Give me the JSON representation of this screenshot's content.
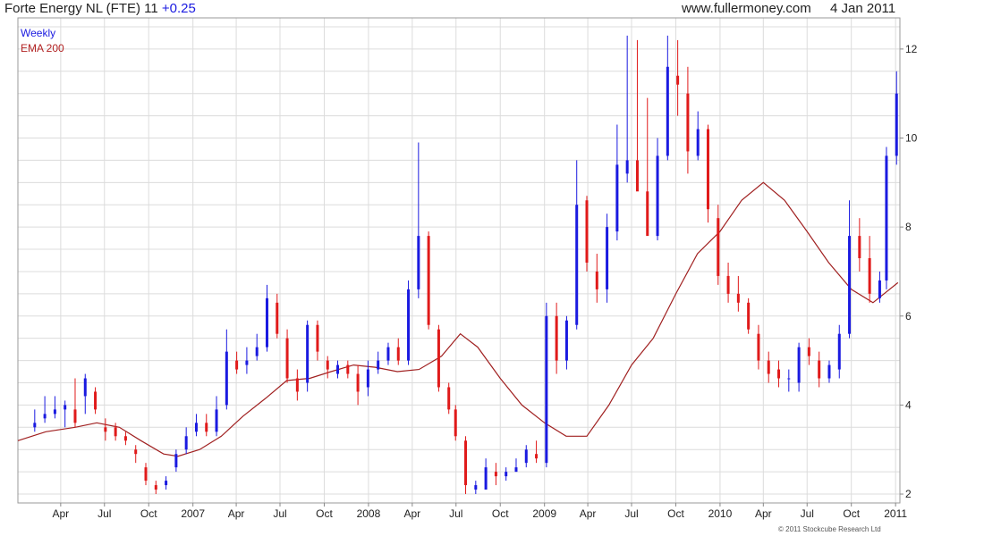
{
  "header": {
    "name": "Forte Energy NL (FTE)",
    "last": "11",
    "change": "+0.25",
    "site": "www.fullermoney.com",
    "date": "4 Jan 2011"
  },
  "legend": {
    "weekly": "Weekly",
    "ema": "EMA 200"
  },
  "footer": {
    "copyright": "© 2011 Stockcube Research Ltd"
  },
  "colors": {
    "up": "#1a1ae0",
    "down": "#e01a1a",
    "ema": "#a02020",
    "grid": "#dcdcdc"
  },
  "chart_data": {
    "type": "line",
    "title": "Forte Energy NL (FTE) 11 +0.25",
    "series": [
      {
        "name": "Weekly",
        "description_unused": "",
        "x": [
          "2006-02-06",
          "2006-02-27",
          "2006-03-20",
          "2006-04-10",
          "2006-05-01",
          "2006-05-22",
          "2006-06-12",
          "2006-07-03",
          "2006-07-24",
          "2006-08-14",
          "2006-09-04",
          "2006-09-25",
          "2006-10-16",
          "2006-11-06",
          "2006-11-27",
          "2006-12-18",
          "2007-01-08",
          "2007-01-29",
          "2007-02-19",
          "2007-03-12",
          "2007-04-02",
          "2007-04-23",
          "2007-05-14",
          "2007-06-04",
          "2007-06-25",
          "2007-07-16",
          "2007-08-06",
          "2007-08-27",
          "2007-09-17",
          "2007-10-08",
          "2007-10-29",
          "2007-11-19",
          "2007-12-10",
          "2007-12-31",
          "2008-01-21",
          "2008-02-11",
          "2008-03-03",
          "2008-03-24",
          "2008-04-14",
          "2008-05-05",
          "2008-05-26",
          "2008-06-16",
          "2008-06-30",
          "2008-07-21",
          "2008-08-11",
          "2008-09-01",
          "2008-09-22",
          "2008-10-13",
          "2008-11-03",
          "2008-11-24",
          "2008-12-15",
          "2009-01-05",
          "2009-01-26",
          "2009-02-16",
          "2009-03-09",
          "2009-03-30",
          "2009-04-20",
          "2009-05-11",
          "2009-06-01",
          "2009-06-22",
          "2009-07-13",
          "2009-08-03",
          "2009-08-24",
          "2009-09-14",
          "2009-10-05",
          "2009-10-26",
          "2009-11-16",
          "2009-12-07",
          "2009-12-28",
          "2010-01-18",
          "2010-02-08",
          "2010-03-01",
          "2010-03-22",
          "2010-04-12",
          "2010-05-03",
          "2010-05-24",
          "2010-06-14",
          "2010-07-05",
          "2010-07-26",
          "2010-08-16",
          "2010-09-06",
          "2010-09-27",
          "2010-10-18",
          "2010-11-08",
          "2010-11-29",
          "2010-12-13",
          "2011-01-03"
        ],
        "y": [
          3.6,
          3.8,
          3.9,
          4.0,
          3.6,
          4.6,
          3.9,
          3.4,
          3.3,
          3.2,
          2.9,
          2.3,
          2.1,
          2.3,
          2.9,
          3.3,
          3.6,
          3.4,
          3.9,
          5.2,
          4.8,
          5.0,
          5.3,
          6.4,
          5.6,
          4.6,
          4.3,
          5.8,
          5.2,
          4.8,
          4.9,
          4.7,
          4.3,
          4.8,
          5.0,
          5.3,
          5.0,
          6.6,
          7.8,
          5.8,
          4.4,
          3.9,
          3.3,
          2.2,
          2.2,
          2.6,
          2.4,
          2.5,
          2.6,
          3.0,
          2.8,
          6.0,
          5.0,
          5.9,
          8.5,
          7.2,
          6.6,
          8.0,
          9.4,
          9.5,
          8.8,
          7.8,
          9.6,
          11.6,
          11.2,
          9.7,
          10.2,
          8.4,
          6.9,
          6.5,
          6.3,
          5.7,
          5.0,
          4.7,
          4.6,
          4.6,
          5.3,
          5.1,
          4.6,
          4.9,
          5.6,
          7.8,
          7.3,
          6.5,
          6.8,
          9.6,
          11.0
        ]
      },
      {
        "name": "EMA 200",
        "x": [
          "2006-01-02",
          "2006-03-01",
          "2006-05-01",
          "2006-06-15",
          "2006-08-01",
          "2006-09-15",
          "2006-11-01",
          "2006-12-01",
          "2007-01-15",
          "2007-03-01",
          "2007-04-15",
          "2007-06-01",
          "2007-07-15",
          "2007-09-01",
          "2007-10-15",
          "2007-12-01",
          "2008-01-15",
          "2008-03-01",
          "2008-04-15",
          "2008-06-01",
          "2008-07-10",
          "2008-08-15",
          "2008-10-01",
          "2008-11-15",
          "2009-01-01",
          "2009-02-15",
          "2009-03-30",
          "2009-05-15",
          "2009-07-01",
          "2009-08-15",
          "2009-10-01",
          "2009-11-15",
          "2010-01-01",
          "2010-02-15",
          "2010-04-01",
          "2010-05-15",
          "2010-07-01",
          "2010-08-15",
          "2010-10-01",
          "2010-11-15",
          "2011-01-06"
        ],
        "y": [
          3.2,
          3.4,
          3.5,
          3.6,
          3.5,
          3.2,
          2.9,
          2.85,
          3.0,
          3.3,
          3.75,
          4.15,
          4.55,
          4.6,
          4.75,
          4.9,
          4.85,
          4.75,
          4.8,
          5.1,
          5.6,
          5.3,
          4.6,
          4.0,
          3.6,
          3.3,
          3.3,
          4.0,
          4.9,
          5.5,
          6.5,
          7.4,
          7.9,
          8.6,
          9.0,
          8.6,
          7.9,
          7.2,
          6.6,
          6.3,
          6.75
        ]
      }
    ],
    "ohlc_weekly_approx": {
      "open": [
        3.5,
        3.7,
        3.8,
        3.9,
        3.9,
        4.2,
        4.3,
        3.5,
        3.5,
        3.3,
        3.0,
        2.6,
        2.2,
        2.2,
        2.6,
        3.0,
        3.4,
        3.6,
        3.4,
        4.0,
        5.0,
        4.9,
        5.1,
        5.3,
        6.3,
        5.5,
        4.6,
        4.5,
        5.8,
        5.0,
        4.7,
        4.9,
        4.7,
        4.4,
        4.8,
        5.0,
        5.3,
        5.0,
        6.6,
        7.8,
        5.7,
        4.4,
        3.9,
        3.2,
        2.1,
        2.1,
        2.5,
        2.4,
        2.5,
        2.7,
        2.9,
        2.7,
        6.0,
        5.0,
        5.8,
        8.6,
        7.0,
        6.6,
        7.9,
        9.2,
        9.5,
        8.8,
        7.8,
        9.6,
        11.4,
        11.0,
        9.6,
        10.2,
        8.2,
        6.9,
        6.5,
        6.3,
        5.6,
        5.0,
        4.8,
        4.6,
        4.5,
        5.3,
        5.0,
        4.6,
        4.8,
        5.6,
        7.8,
        7.3,
        6.4,
        6.8,
        9.6
      ],
      "high": [
        3.9,
        4.2,
        4.2,
        4.1,
        4.6,
        4.7,
        4.4,
        3.7,
        3.6,
        3.4,
        3.1,
        2.7,
        2.3,
        2.4,
        3.0,
        3.5,
        3.8,
        3.8,
        4.2,
        5.7,
        5.2,
        5.3,
        5.6,
        6.7,
        6.5,
        5.7,
        4.8,
        5.9,
        5.9,
        5.1,
        5.0,
        5.0,
        4.9,
        5.0,
        5.2,
        5.4,
        5.5,
        6.8,
        9.9,
        7.9,
        5.8,
        4.5,
        4.0,
        3.3,
        2.3,
        2.8,
        2.7,
        2.6,
        2.8,
        3.1,
        3.2,
        6.3,
        6.3,
        6.0,
        9.5,
        8.7,
        7.4,
        8.3,
        10.3,
        12.3,
        12.2,
        10.9,
        10.0,
        12.3,
        12.2,
        11.6,
        10.6,
        10.3,
        8.5,
        7.2,
        6.9,
        6.4,
        5.8,
        5.2,
        5.0,
        4.8,
        5.4,
        5.5,
        5.2,
        5.0,
        5.8,
        8.6,
        8.2,
        7.8,
        7.0,
        9.8,
        11.5
      ],
      "low": [
        3.4,
        3.6,
        3.7,
        3.5,
        3.5,
        3.8,
        3.8,
        3.2,
        3.2,
        3.1,
        2.7,
        2.2,
        2.0,
        2.1,
        2.5,
        2.9,
        3.3,
        3.3,
        3.3,
        3.9,
        4.7,
        4.7,
        5.0,
        5.2,
        5.5,
        4.5,
        4.1,
        4.3,
        5.0,
        4.6,
        4.6,
        4.6,
        4.0,
        4.2,
        4.7,
        4.9,
        4.9,
        4.9,
        6.4,
        5.7,
        4.3,
        3.8,
        3.2,
        2.0,
        2.0,
        2.1,
        2.2,
        2.3,
        2.5,
        2.6,
        2.7,
        2.6,
        4.7,
        4.8,
        5.7,
        7.0,
        6.3,
        6.3,
        7.7,
        9.0,
        9.1,
        8.2,
        7.7,
        9.5,
        10.5,
        9.2,
        9.5,
        8.1,
        6.7,
        6.3,
        6.1,
        5.6,
        4.8,
        4.5,
        4.4,
        4.3,
        4.3,
        4.9,
        4.4,
        4.5,
        4.6,
        5.5,
        7.0,
        6.3,
        6.3,
        6.6,
        9.4
      ]
    },
    "y_ticks": [
      "2",
      "4",
      "6",
      "8",
      "10",
      "12"
    ],
    "x_ticks": [
      "Apr",
      "Jul",
      "Oct",
      "2007",
      "Apr",
      "Jul",
      "Oct",
      "2008",
      "Apr",
      "Jul",
      "Oct",
      "2009",
      "Apr",
      "Jul",
      "Oct",
      "2010",
      "Apr",
      "Jul",
      "Oct",
      "2011"
    ],
    "x_tick_dates": [
      "2006-04-01",
      "2006-07-01",
      "2006-10-01",
      "2007-01-01",
      "2007-04-01",
      "2007-07-01",
      "2007-10-01",
      "2008-01-01",
      "2008-04-01",
      "2008-07-01",
      "2008-10-01",
      "2009-01-01",
      "2009-04-01",
      "2009-07-01",
      "2009-10-01",
      "2010-01-01",
      "2010-04-01",
      "2010-07-01",
      "2010-10-01",
      "2011-01-01"
    ],
    "xlim": [
      "2006-01-02",
      "2011-01-10"
    ],
    "ylim": [
      1.8,
      12.7
    ],
    "grid": true,
    "legend_position": "top-left"
  }
}
